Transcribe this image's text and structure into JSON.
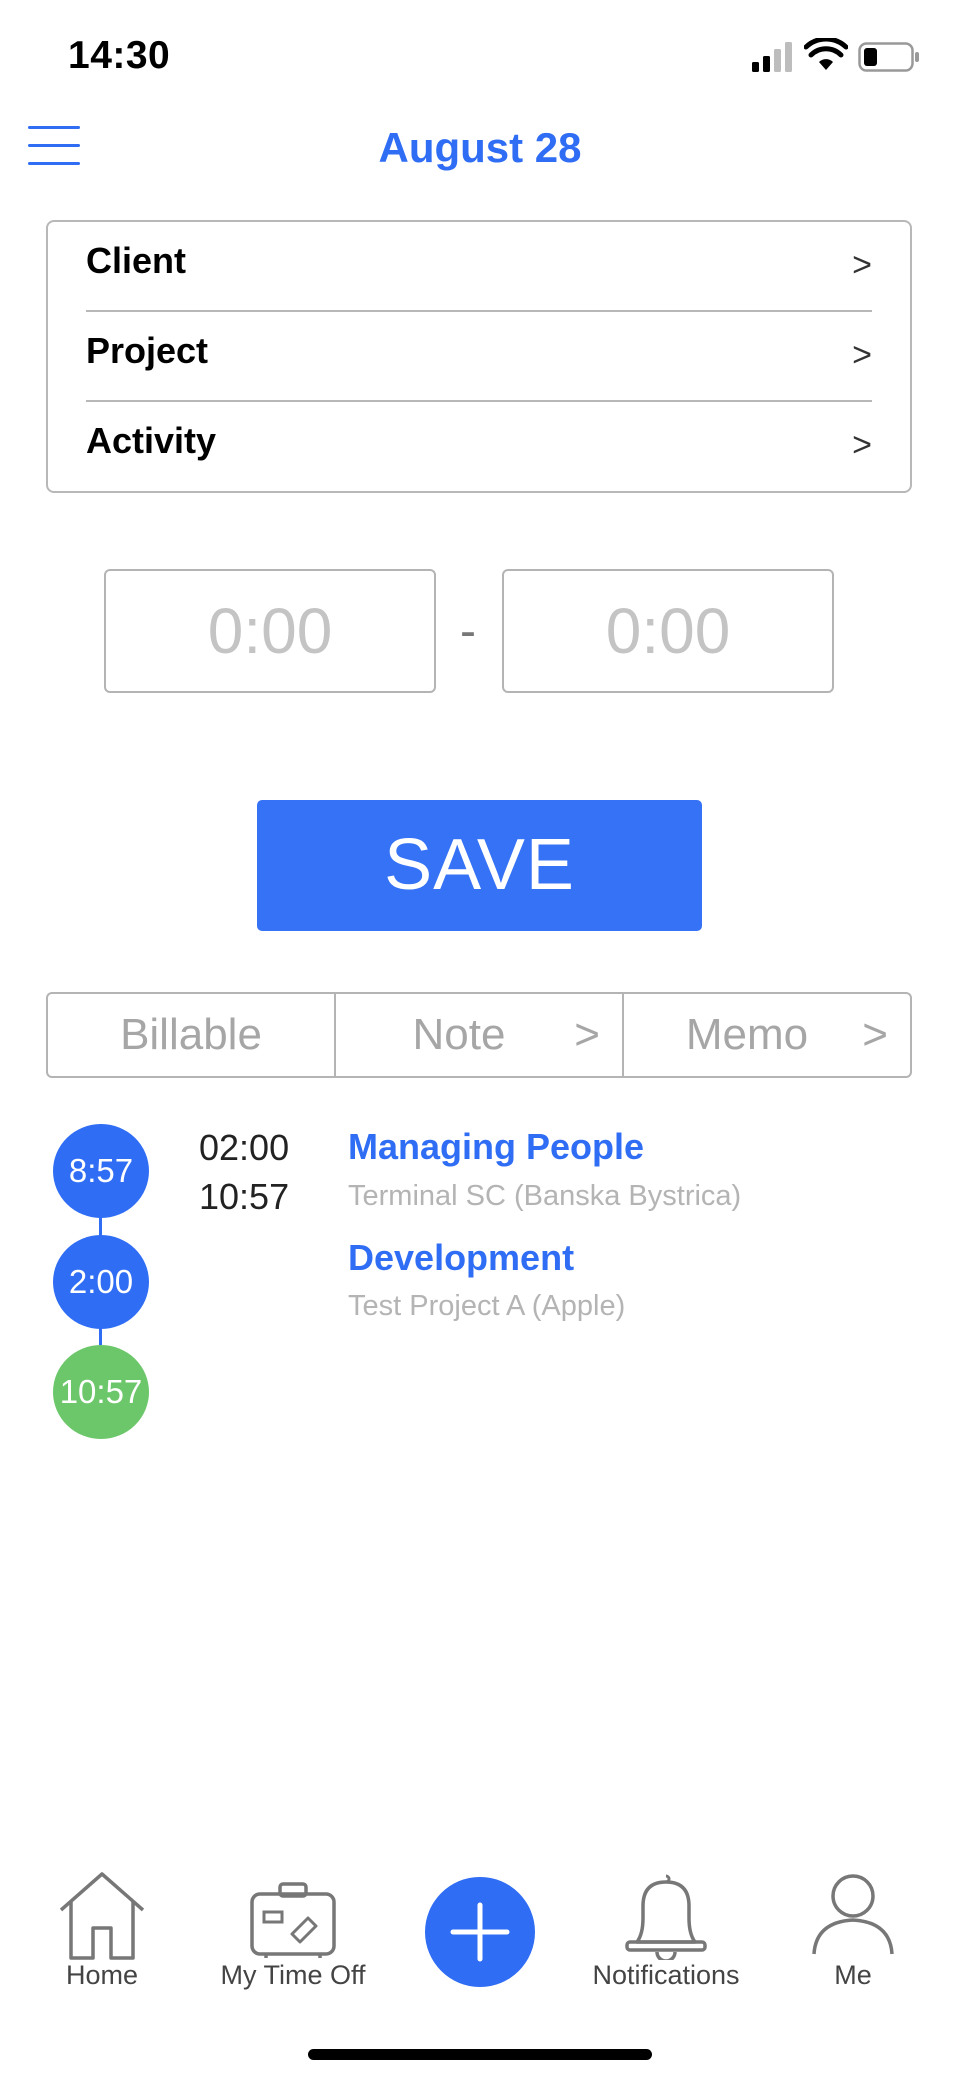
{
  "status_bar": {
    "time": "14:30"
  },
  "header": {
    "title": "August 28"
  },
  "selectors": [
    {
      "label": "Client",
      "chevron": ">"
    },
    {
      "label": "Project",
      "chevron": ">"
    },
    {
      "label": "Activity",
      "chevron": ">"
    }
  ],
  "time_range": {
    "start_placeholder": "0:00",
    "end_placeholder": "0:00",
    "separator": "-"
  },
  "save_label": "SAVE",
  "options": [
    {
      "label": "Billable"
    },
    {
      "label": "Note",
      "chevron": ">"
    },
    {
      "label": "Memo",
      "chevron": ">"
    }
  ],
  "timeline": {
    "markers": [
      "8:57",
      "2:00",
      "10:57"
    ],
    "marker_colors": {
      "blue": "#2f6df5",
      "green": "#6cc76a"
    },
    "times": [
      "02:00",
      "10:57"
    ],
    "entries": [
      {
        "title": "Managing People",
        "subtitle": "Terminal SC (Banska Bystrica)"
      },
      {
        "title": "Development",
        "subtitle": "Test Project A (Apple)"
      }
    ]
  },
  "tabbar": {
    "items": [
      {
        "label": "Home",
        "icon": "home-icon"
      },
      {
        "label": "My Time Off",
        "icon": "suitcase-icon"
      },
      {
        "label": "",
        "icon": "plus-icon"
      },
      {
        "label": "Notifications",
        "icon": "bell-icon"
      },
      {
        "label": "Me",
        "icon": "person-icon"
      }
    ]
  },
  "colors": {
    "accent": "#2f6df5",
    "save": "#3572f6",
    "success": "#6cc76a"
  }
}
